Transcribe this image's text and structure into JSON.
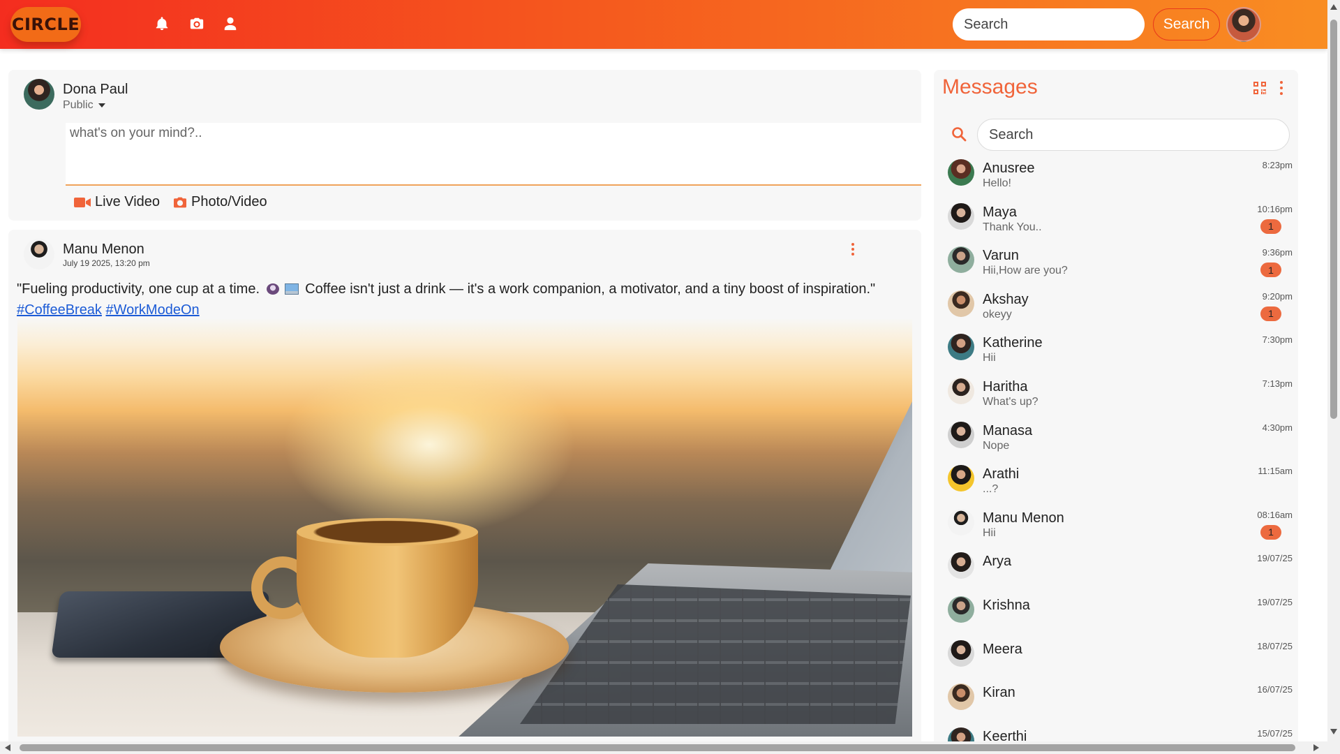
{
  "app": {
    "logo_text": "CIRCLE",
    "brand_gradient": [
      "#f42d1f",
      "#f98d22"
    ],
    "accent_color": "#f0643a"
  },
  "header": {
    "nav_icons": [
      "bell-icon",
      "camera-icon",
      "user-icon"
    ],
    "search_placeholder": "Search",
    "search_button_label": "Search"
  },
  "composer": {
    "user_name": "Dona Paul",
    "privacy": "Public",
    "placeholder": "what's on your mind?..",
    "actions": [
      {
        "label": "Live Video",
        "icon": "video-camera-icon"
      },
      {
        "label": "Photo/Video",
        "icon": "camera-icon"
      }
    ]
  },
  "post": {
    "author": "Manu Menon",
    "timestamp": "July 19 2025, 13:20 pm",
    "text_part1": "\"Fueling productivity, one cup at a time.",
    "text_part2": "Coffee isn't just a drink — it's a work companion, a motivator, and a tiny boost of inspiration.\"",
    "emojis": [
      "coffee-emoji",
      "laptop-emoji"
    ],
    "hashtags": [
      "#CoffeeBreak",
      "#WorkModeOn"
    ],
    "image_description_icon": "coffee-laptop-photo"
  },
  "messages": {
    "title": "Messages",
    "search_placeholder": "Search",
    "conversations": [
      {
        "name": "Anusree",
        "preview": "Hello!",
        "time": "8:23pm",
        "unread": ""
      },
      {
        "name": "Maya",
        "preview": "Thank You..",
        "time": "10:16pm",
        "unread": "1"
      },
      {
        "name": "Varun",
        "preview": "Hii,How are you?",
        "time": "9:36pm",
        "unread": "1"
      },
      {
        "name": "Akshay",
        "preview": "okeyy",
        "time": "9:20pm",
        "unread": "1"
      },
      {
        "name": "Katherine",
        "preview": "Hii",
        "time": "7:30pm",
        "unread": ""
      },
      {
        "name": "Haritha",
        "preview": "What's up?",
        "time": "7:13pm",
        "unread": ""
      },
      {
        "name": "Manasa",
        "preview": "Nope",
        "time": "4:30pm",
        "unread": ""
      },
      {
        "name": "Arathi",
        "preview": "...?",
        "time": "11:15am",
        "unread": ""
      },
      {
        "name": "Manu Menon",
        "preview": "Hii",
        "time": "08:16am",
        "unread": "1"
      },
      {
        "name": "Arya",
        "preview": "",
        "time": "19/07/25",
        "unread": ""
      },
      {
        "name": "Krishna",
        "preview": "",
        "time": "19/07/25",
        "unread": ""
      },
      {
        "name": "Meera",
        "preview": "",
        "time": "18/07/25",
        "unread": ""
      },
      {
        "name": "Kiran",
        "preview": "",
        "time": "16/07/25",
        "unread": ""
      },
      {
        "name": "Keerthi",
        "preview": "",
        "time": "15/07/25",
        "unread": ""
      }
    ]
  }
}
